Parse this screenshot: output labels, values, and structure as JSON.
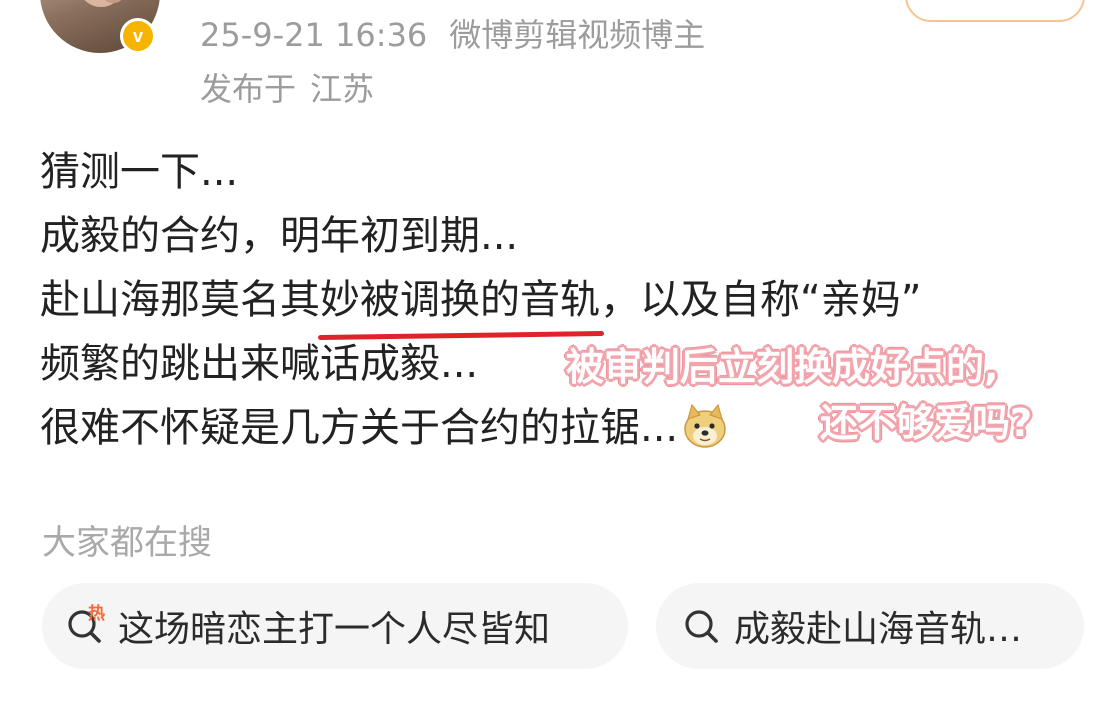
{
  "post": {
    "timestamp": "25-9-21 16:36",
    "source": "微博剪辑视频博主",
    "location_prefix": "发布于",
    "location": "江苏",
    "badge": "v",
    "lines": {
      "l1": "猜测一下...",
      "l2": "成毅的合约，明年初到期...",
      "l3_before": "赴山海那莫名其",
      "l3_underlined": "妙被调换的音轨",
      "l3_after": "，以及自称“亲妈”",
      "l4": "频繁的跳出来喊话成毅...",
      "l5": "很难不怀疑是几方关于合约的拉锯..."
    },
    "emoji_icon": "doge-emoji-icon"
  },
  "annotation": {
    "line1": "被审判后立刻换成好点的,",
    "line2": "还不够爱吗?",
    "color": "#ee8e99",
    "underline_color": "#e0232a"
  },
  "search": {
    "section_title": "大家都在搜",
    "chips": [
      {
        "label": "这场暗恋主打一个人尽皆知",
        "icon": "hot-search-icon",
        "hot_mark": "热"
      },
      {
        "label": "成毅赴山海音轨…",
        "icon": "search-icon"
      }
    ]
  }
}
